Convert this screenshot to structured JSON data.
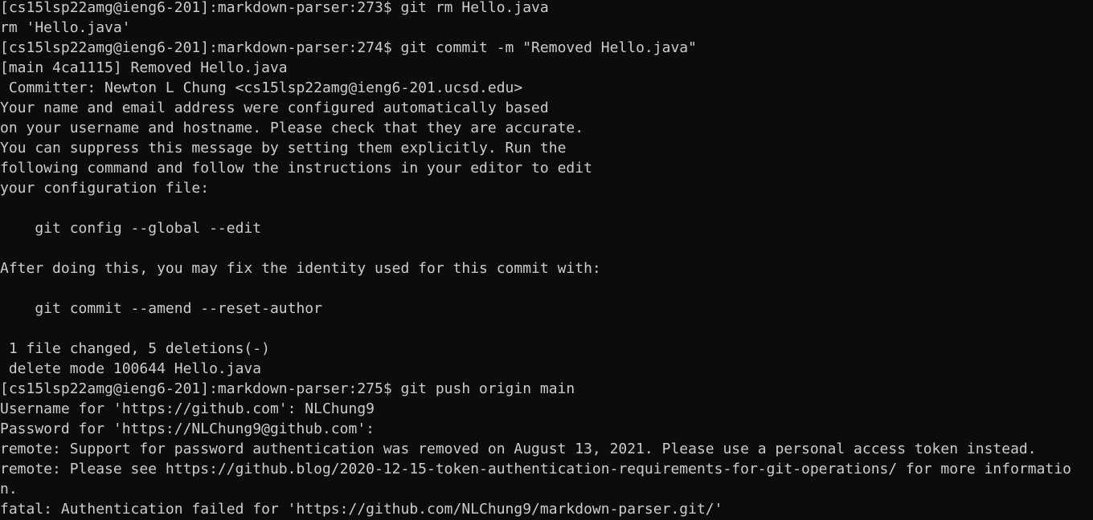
{
  "terminal": {
    "lines": [
      "[cs15lsp22amg@ieng6-201]:markdown-parser:273$ git rm Hello.java",
      "rm 'Hello.java'",
      "[cs15lsp22amg@ieng6-201]:markdown-parser:274$ git commit -m \"Removed Hello.java\"",
      "[main 4ca1115] Removed Hello.java",
      " Committer: Newton L Chung <cs15lsp22amg@ieng6-201.ucsd.edu>",
      "Your name and email address were configured automatically based",
      "on your username and hostname. Please check that they are accurate.",
      "You can suppress this message by setting them explicitly. Run the",
      "following command and follow the instructions in your editor to edit",
      "your configuration file:",
      "",
      "    git config --global --edit",
      "",
      "After doing this, you may fix the identity used for this commit with:",
      "",
      "    git commit --amend --reset-author",
      "",
      " 1 file changed, 5 deletions(-)",
      " delete mode 100644 Hello.java",
      "[cs15lsp22amg@ieng6-201]:markdown-parser:275$ git push origin main",
      "Username for 'https://github.com': NLChung9",
      "Password for 'https://NLChung9@github.com':",
      "remote: Support for password authentication was removed on August 13, 2021. Please use a personal access token instead.",
      "remote: Please see https://github.blog/2020-12-15-token-authentication-requirements-for-git-operations/ for more informatio",
      "n.",
      "fatal: Authentication failed for 'https://github.com/NLChung9/markdown-parser.git/'"
    ]
  },
  "colors": {
    "background": "#0c0c0c",
    "foreground": "#cccccc"
  }
}
